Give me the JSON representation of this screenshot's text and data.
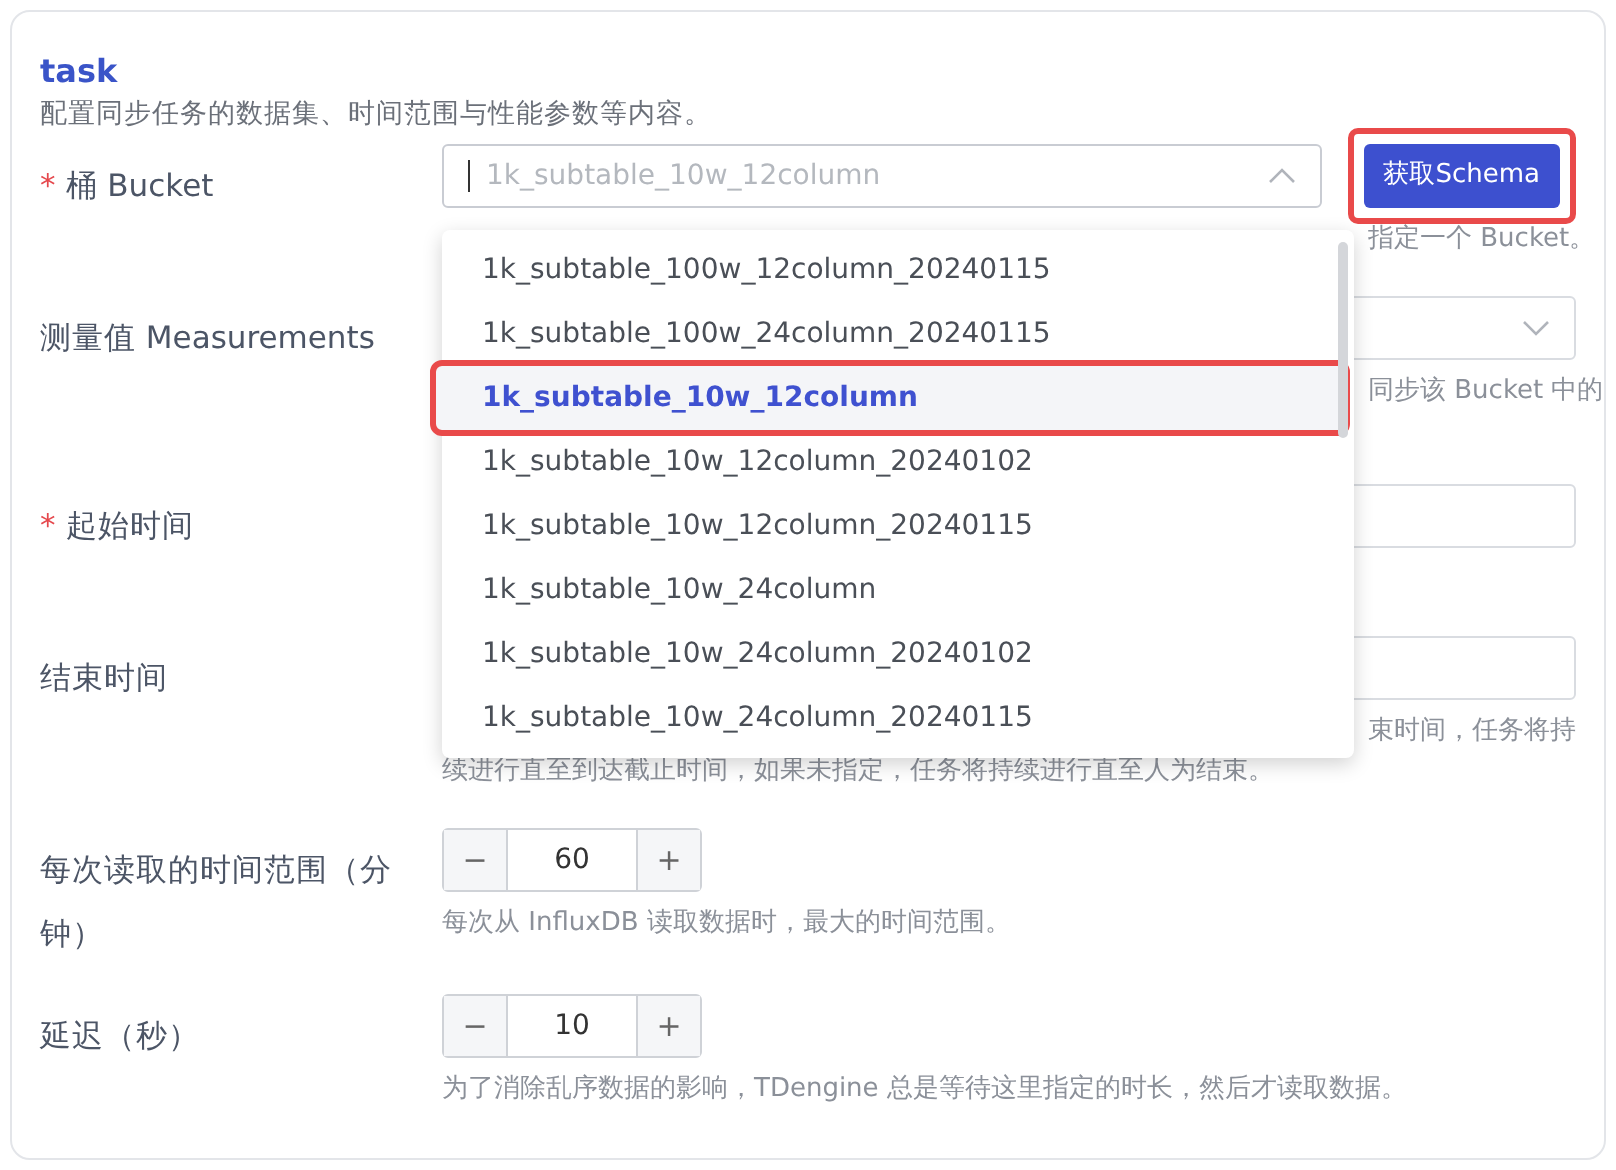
{
  "section": {
    "title": "task",
    "description": "配置同步任务的数据集、时间范围与性能参数等内容。"
  },
  "fields": [
    {
      "kind": "select",
      "label": "桶 Bucket",
      "required_mark": "*",
      "placeholder": "1k_subtable_10w_12column",
      "expanded": true,
      "button": {
        "label": "获取Schema",
        "highlighted": true
      },
      "hint_lines": [
        "指定一个 Bucket。"
      ]
    },
    {
      "kind": "select",
      "label": "测量值 Measurements",
      "expanded": false,
      "hint_lines": [
        "同步该 Bucket 中的"
      ]
    },
    {
      "kind": "input",
      "label": "起始时间",
      "required_mark": "*"
    },
    {
      "kind": "input",
      "label": "结束时间",
      "hint_lines": [
        "束时间，任务将持",
        "续进行直至到达截止时间，如果未指定，任务将持续进行直至人为结束。"
      ]
    },
    {
      "kind": "number",
      "label": "每次读取的时间范围（分钟）",
      "value": "60",
      "minus": "−",
      "plus": "+",
      "hint_lines": [
        "每次从 InfluxDB 读取数据时，最大的时间范围。"
      ]
    },
    {
      "kind": "number",
      "label": "延迟（秒）",
      "value": "10",
      "minus": "−",
      "plus": "+",
      "hint_lines": [
        "为了消除乱序数据的影响，TDengine 总是等待这里指定的时长，然后才读取数据。"
      ]
    }
  ],
  "dropdown": {
    "options": [
      {
        "label": "1k_subtable_100w_12column_20240115",
        "selected": false,
        "highlighted": false
      },
      {
        "label": "1k_subtable_100w_24column_20240115",
        "selected": false,
        "highlighted": false
      },
      {
        "label": "1k_subtable_10w_12column",
        "selected": true,
        "highlighted": true
      },
      {
        "label": "1k_subtable_10w_12column_20240102",
        "selected": false,
        "highlighted": false
      },
      {
        "label": "1k_subtable_10w_12column_20240115",
        "selected": false,
        "highlighted": false
      },
      {
        "label": "1k_subtable_10w_24column",
        "selected": false,
        "highlighted": false
      },
      {
        "label": "1k_subtable_10w_24column_20240102",
        "selected": false,
        "highlighted": false
      },
      {
        "label": "1k_subtable_10w_24column_20240115",
        "selected": false,
        "highlighted": false
      }
    ]
  }
}
